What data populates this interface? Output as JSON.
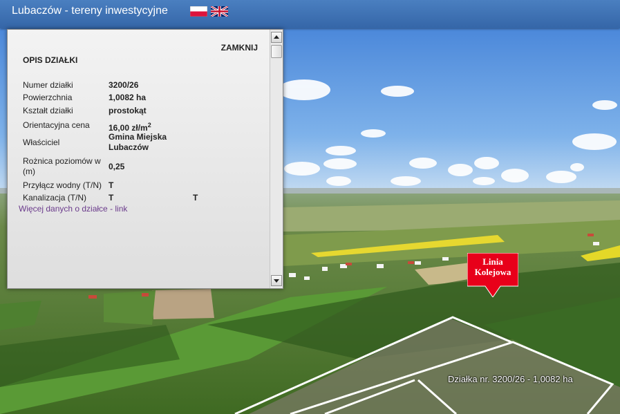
{
  "app": {
    "title": "Lubaczów - tereny inwestycyjne"
  },
  "languages": [
    {
      "code": "pl",
      "icon": "flag-pl-icon"
    },
    {
      "code": "en",
      "icon": "flag-gb-icon"
    }
  ],
  "panel": {
    "close_label": "ZAMKNIJ",
    "heading": "OPIS DZIAŁKI",
    "rows": [
      {
        "label": "Numer działki",
        "value": "3200/26"
      },
      {
        "label": "Powierzchnia",
        "value": "1,0082 ha"
      },
      {
        "label": "Kształt działki",
        "value": "prostokąt"
      },
      {
        "label": "Orientacyjna cena",
        "value": "16,00 zł/m",
        "sup": "2"
      },
      {
        "label": "Właściciel",
        "value": "Gmina Miejska Lubaczów"
      },
      {
        "label": "Rożnica poziomów w (m)",
        "value": "0,25"
      },
      {
        "label": "Przyłącz wodny (T/N)",
        "value": "T"
      },
      {
        "label": "Kanalizacja (T/N)",
        "value": "T",
        "extra": "T"
      }
    ],
    "more_link": "Więcej danych o działce - link"
  },
  "map": {
    "marker_label_line1": "Linia",
    "marker_label_line2": "Kolejowa",
    "plot_label": "Działka nr. 3200/26 - 1,0082 ha"
  },
  "colors": {
    "accent": "#3a6fb3",
    "marker": "#e8001a",
    "link": "#6b3b8c"
  }
}
